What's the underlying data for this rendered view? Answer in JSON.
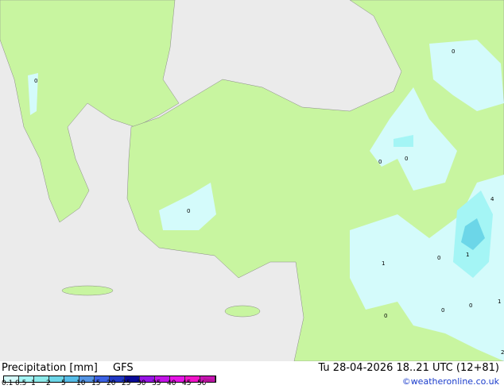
{
  "title": "Precipitation [mm]",
  "model": "GFS",
  "valid_time": "Tu 28-04-2026 18..21 UTC (12+81)",
  "credit": "©weatheronline.co.uk",
  "legend": {
    "labels": [
      "0.1",
      "0.5",
      "1",
      "2",
      "5",
      "10",
      "15",
      "20",
      "25",
      "30",
      "35",
      "40",
      "45",
      "50"
    ],
    "colors": [
      "#d4fbfb",
      "#a4f5f5",
      "#8ceaea",
      "#6cd6e8",
      "#56bde8",
      "#5494e4",
      "#3c62e4",
      "#2038c4",
      "#0a0a98",
      "#9614e6",
      "#c214e6",
      "#e614e6",
      "#f014c8",
      "#c814b4"
    ]
  },
  "map_colors": {
    "sea": "#ebebeb",
    "land": "#c8f5a0",
    "precip_light": "#d4fbfb",
    "precip_mid": "#a4f5f5",
    "precip_heavy": "#6cd6e8"
  },
  "map_labels": [
    "0",
    "0",
    "0",
    "0",
    "0",
    "0",
    "0",
    "0",
    "0",
    "1",
    "1",
    "1",
    "4",
    "2"
  ]
}
